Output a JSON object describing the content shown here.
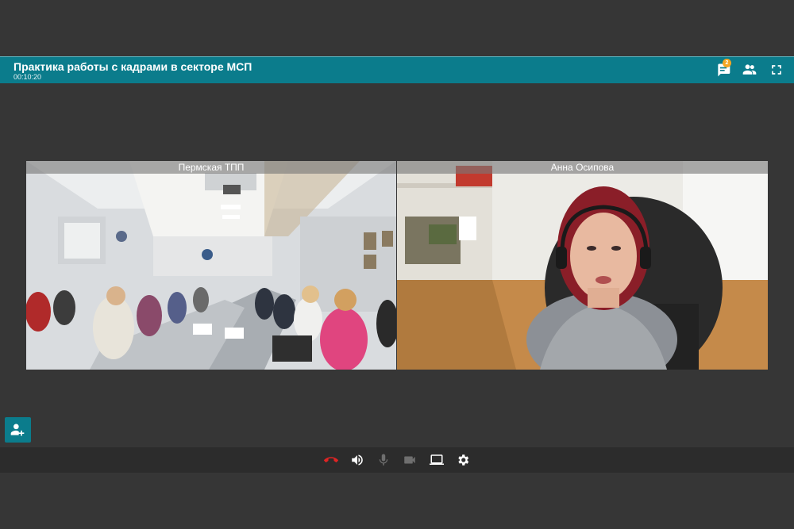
{
  "header": {
    "title": "Практика работы с кадрами в секторе МСП",
    "timer": "00:10:20",
    "chat_badge": "2",
    "icons": [
      "chat-icon",
      "participants-icon",
      "fullscreen-icon"
    ]
  },
  "videos": [
    {
      "name": "Пермская ТПП"
    },
    {
      "name": "Анна Осипова"
    }
  ],
  "toolbar": {
    "icons": [
      "hangup-icon",
      "volume-icon",
      "microphone-icon",
      "camera-icon",
      "screen-share-icon",
      "settings-icon"
    ]
  },
  "colors": {
    "accent": "#0b7c8c",
    "hangup": "#e02424",
    "badge": "#f5a623"
  }
}
